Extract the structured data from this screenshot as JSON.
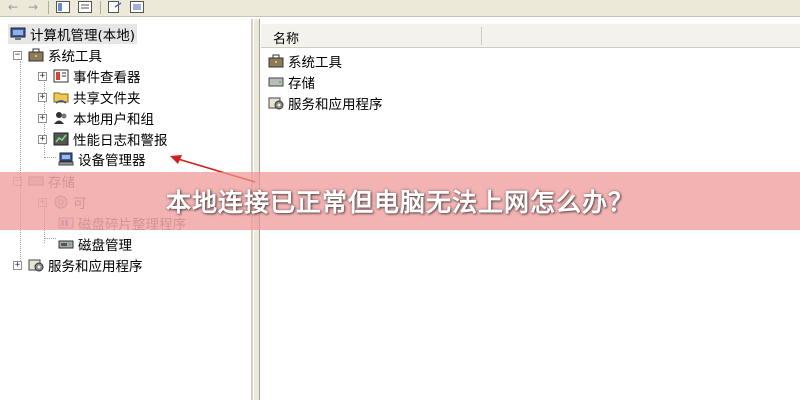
{
  "toolbar": {
    "back_glyph": "←",
    "forward_glyph": "→"
  },
  "tree": {
    "root": "计算机管理(本地)",
    "system_tools": "系统工具",
    "event_viewer": "事件查看器",
    "shared_folders": "共享文件夹",
    "local_users": "本地用户和组",
    "perf_logs": "性能日志和警报",
    "device_manager": "设备管理器",
    "storage": "存储",
    "removable_storage": "可",
    "defrag": "磁盘碎片整理程序",
    "disk_mgmt": "磁盘管理",
    "services_apps": "服务和应用程序",
    "expand_glyph": "+",
    "collapse_glyph": "−"
  },
  "list": {
    "column_name": "名称",
    "items": [
      "系统工具",
      "存储",
      "服务和应用程序"
    ]
  },
  "banner": {
    "title": "本地连接已正常但电脑无法上网怎么办？"
  },
  "colors": {
    "arrow": "#d02020",
    "banner": "#ee9696"
  }
}
